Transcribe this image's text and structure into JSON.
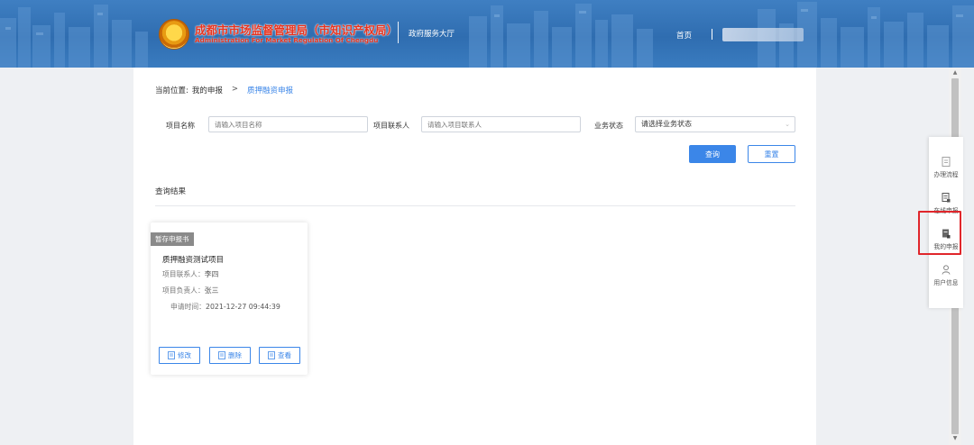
{
  "header": {
    "logo_cn": "成都市市场监督管理局（市知识产权局）",
    "logo_en": "Administration For Market Regulation Of Chengdu",
    "hall": "政府服务大厅",
    "home": "首页"
  },
  "breadcrumb": {
    "label": "当前位置:",
    "item1": "我的申报",
    "sep": ">",
    "item2": "质押融资申报"
  },
  "filters": {
    "project_name_label": "项目名称",
    "project_name_placeholder": "请输入项目名称",
    "contact_label": "项目联系人",
    "contact_placeholder": "请输入项目联系人",
    "status_label": "业务状态",
    "status_value": "请选择业务状态"
  },
  "buttons": {
    "search": "查询",
    "reset": "重置"
  },
  "results": {
    "title": "查询结果"
  },
  "card": {
    "badge": "暂存申报书",
    "title": "质押融资测试项目",
    "contact_key": "项目联系人：",
    "contact_val": "李四",
    "owner_key": "项目负责人：",
    "owner_val": "张三",
    "time_key": "申请时间：",
    "time_val": "2021-12-27 09:44:39",
    "edit": "修改",
    "delete": "删除",
    "view": "查看"
  },
  "side_nav": {
    "item1": "办理流程",
    "item2": "在线申报",
    "item3": "我的申报",
    "item4": "用户信息"
  },
  "colors": {
    "accent": "#3b86e8",
    "header": "#2f6db0",
    "highlight": "#e0262b"
  }
}
